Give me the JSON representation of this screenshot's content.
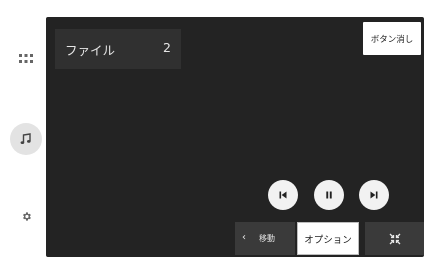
{
  "sidebar": {
    "items": [
      {
        "icon": "grid-icon"
      },
      {
        "icon": "music-note-icon",
        "active": true
      },
      {
        "icon": "gear-icon"
      }
    ]
  },
  "file_panel": {
    "label": "ファイル",
    "count": "2"
  },
  "cancel_button": {
    "label": "ボタン消し"
  },
  "playback": {
    "controls": [
      {
        "icon": "previous-track-icon"
      },
      {
        "icon": "pause-icon"
      },
      {
        "icon": "next-track-icon"
      }
    ]
  },
  "bottom_bar": {
    "move_label": "移動",
    "options_label": "オプション",
    "shrink_icon": "shrink-icon"
  },
  "colors": {
    "screen_bg": "#232323",
    "panel_bg": "#303030",
    "button_bg": "#3a3a3a",
    "active_bg": "#e3e3e3"
  }
}
